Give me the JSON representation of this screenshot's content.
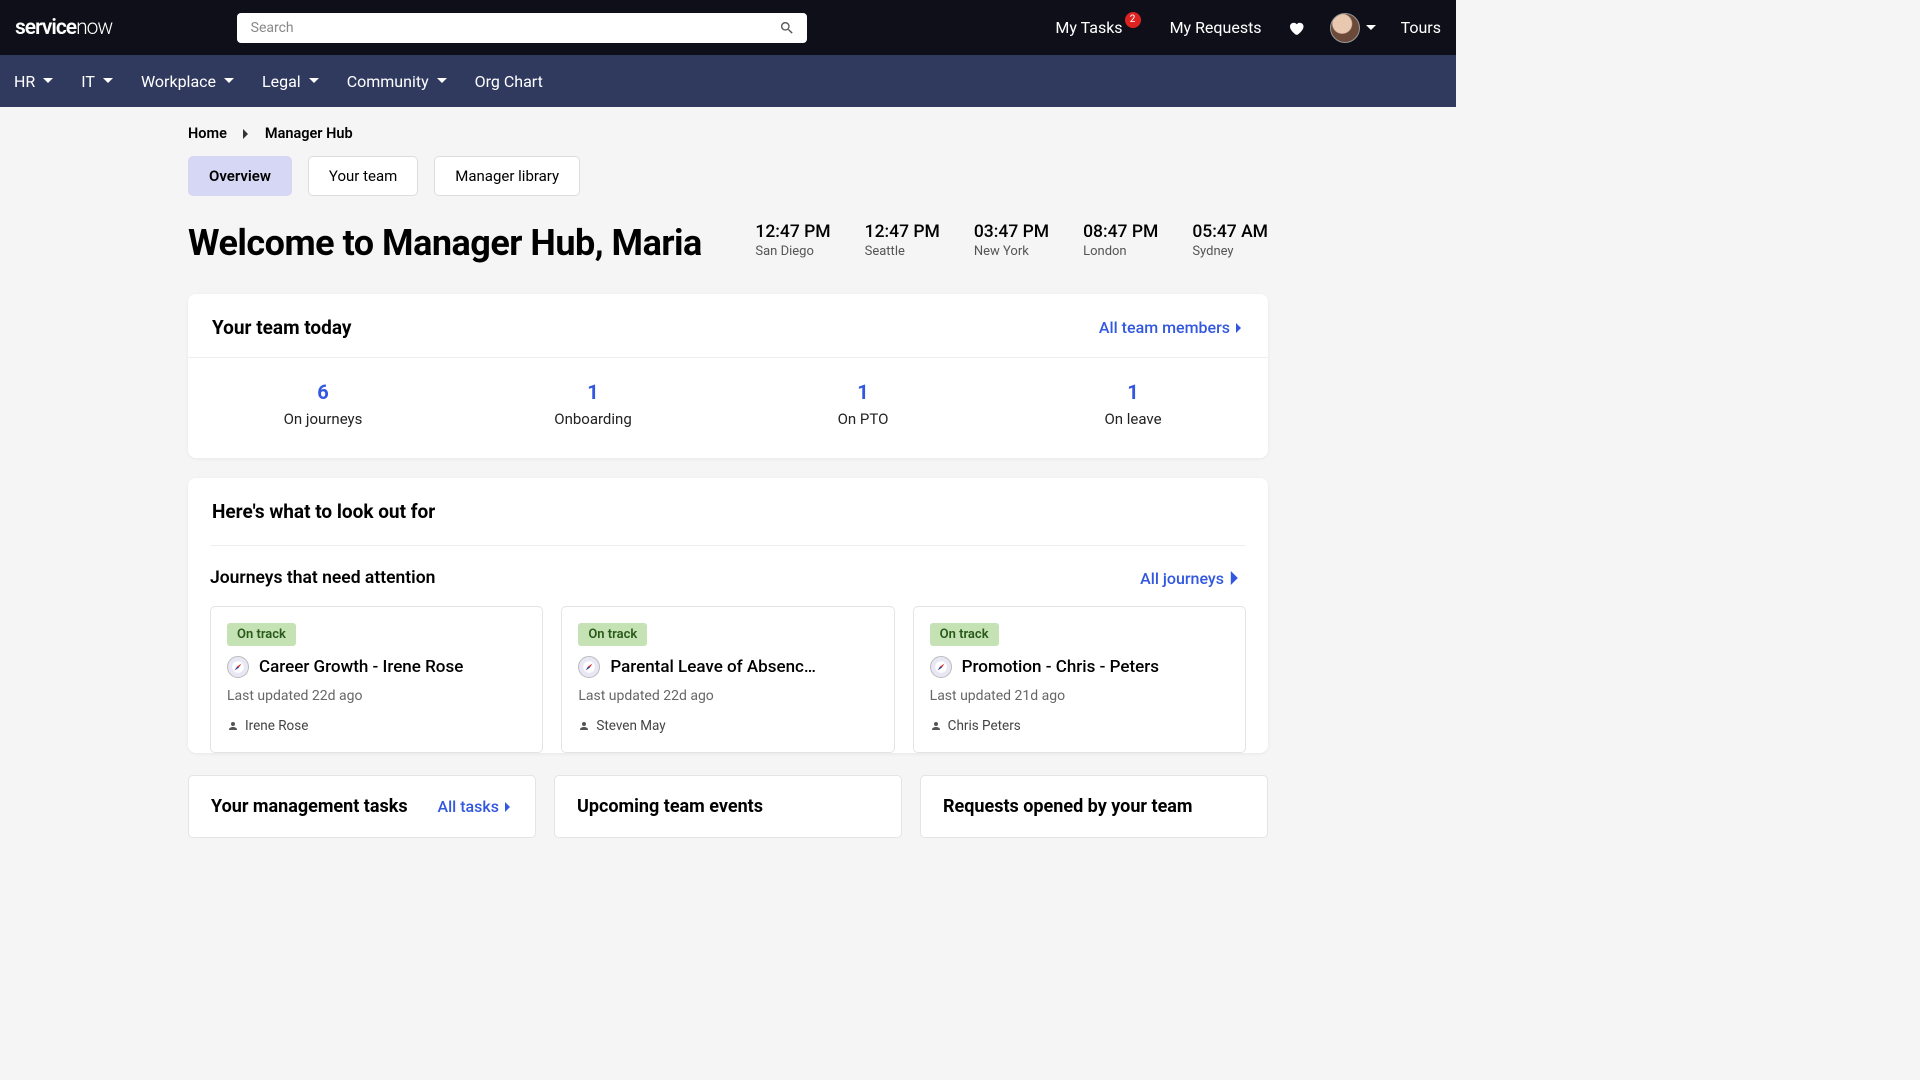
{
  "top": {
    "logo_a": "service",
    "logo_b": "now",
    "search_placeholder": "Search",
    "my_tasks": "My Tasks",
    "my_tasks_badge": "2",
    "my_requests": "My Requests",
    "tours": "Tours"
  },
  "nav": {
    "items": [
      "HR",
      "IT",
      "Workplace",
      "Legal",
      "Community",
      "Org Chart"
    ],
    "has_caret": [
      true,
      true,
      true,
      true,
      true,
      false
    ]
  },
  "breadcrumb": {
    "home": "Home",
    "current": "Manager Hub"
  },
  "tabs": [
    {
      "label": "Overview",
      "active": true
    },
    {
      "label": "Your team",
      "active": false
    },
    {
      "label": "Manager library",
      "active": false
    }
  ],
  "page_title": "Welcome to Manager Hub, Maria",
  "clocks": [
    {
      "time": "12:47 PM",
      "city": "San Diego"
    },
    {
      "time": "12:47 PM",
      "city": "Seattle"
    },
    {
      "time": "03:47 PM",
      "city": "New York"
    },
    {
      "time": "08:47 PM",
      "city": "London"
    },
    {
      "time": "05:47 AM",
      "city": "Sydney"
    }
  ],
  "team_today": {
    "title": "Your team today",
    "link": "All team members",
    "stats": [
      {
        "num": "6",
        "label": "On journeys"
      },
      {
        "num": "1",
        "label": "Onboarding"
      },
      {
        "num": "1",
        "label": "On PTO"
      },
      {
        "num": "1",
        "label": "On leave"
      }
    ]
  },
  "lookout": {
    "title": "Here's what to look out for",
    "journeys_title": "Journeys that need attention",
    "all_link": "All journeys",
    "cards": [
      {
        "status": "On track",
        "title": "Career Growth - Irene Rose",
        "updated": "Last updated 22d ago",
        "person": "Irene Rose"
      },
      {
        "status": "On track",
        "title": "Parental Leave of Absenc…",
        "updated": "Last updated 22d ago",
        "person": "Steven May"
      },
      {
        "status": "On track",
        "title": "Promotion - Chris - Peters",
        "updated": "Last updated 21d ago",
        "person": "Chris Peters"
      }
    ]
  },
  "bottom": {
    "tasks_title": "Your management tasks",
    "tasks_link": "All tasks",
    "events_title": "Upcoming team events",
    "requests_title": "Requests opened by your team"
  }
}
